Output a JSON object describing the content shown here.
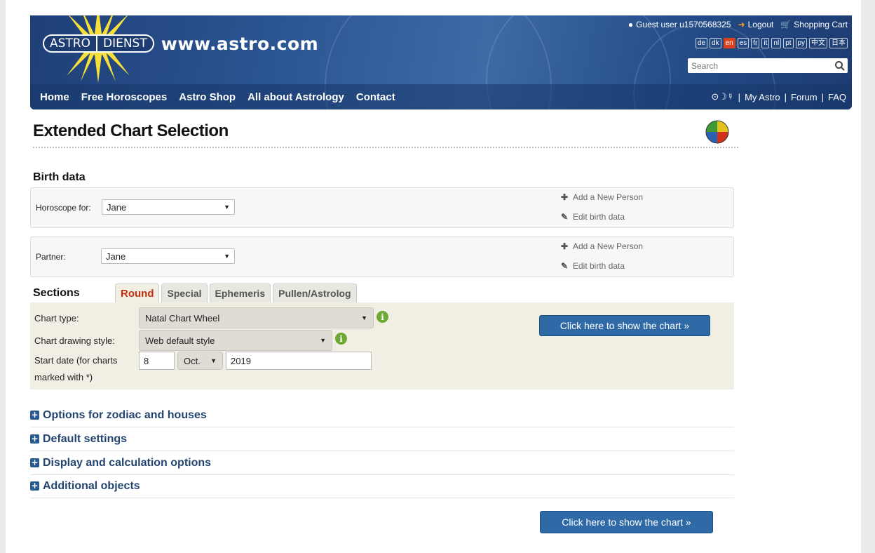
{
  "header": {
    "logo_left": "ASTRO",
    "logo_right": "DIENST",
    "logo_url": "www.astro.com",
    "user_label": "Guest user u1570568325",
    "logout_label": "Logout",
    "cart_label": "Shopping Cart",
    "languages": [
      "de",
      "dk",
      "en",
      "es",
      "fr",
      "it",
      "nl",
      "pt",
      "ру",
      "中文",
      "日本"
    ],
    "active_language": "en",
    "search_placeholder": "Search",
    "nav": [
      "Home",
      "Free Horoscopes",
      "Astro Shop",
      "All about Astrology",
      "Contact"
    ],
    "right_symbols": "⊙☽☿",
    "right_links": [
      "My Astro",
      "Forum",
      "FAQ"
    ],
    "sep": "|"
  },
  "page": {
    "title": "Extended Chart Selection"
  },
  "birth": {
    "heading": "Birth data",
    "horoscope_label": "Horoscope for:",
    "horoscope_value": "Jane",
    "partner_label": "Partner:",
    "partner_value": "Jane",
    "add_person": "Add a New Person",
    "edit_birth": "Edit birth data"
  },
  "sections": {
    "heading": "Sections",
    "tabs": [
      "Round",
      "Special",
      "Ephemeris",
      "Pullen/Astrolog"
    ],
    "active_tab": "Round",
    "chart_type_label": "Chart type:",
    "chart_type_value": "Natal Chart Wheel",
    "drawing_label": "Chart drawing style:",
    "drawing_value": "Web default style",
    "start_label_1": "Start date (for charts",
    "start_label_2": "marked with *)",
    "start_day": "8",
    "start_month": "Oct.",
    "start_year": "2019",
    "show_button": "Click here to show the chart »"
  },
  "accordion": [
    "Options for zodiac and houses",
    "Default settings",
    "Display and calculation options",
    "Additional objects"
  ],
  "bottom_button": "Click here to show the chart »",
  "colors": {
    "header_blue": "#2b5593",
    "active_tab_red": "#c62d0c",
    "button_blue": "#2f6aa7",
    "info_green": "#6ca832",
    "panel_beige": "#f1efe4"
  }
}
